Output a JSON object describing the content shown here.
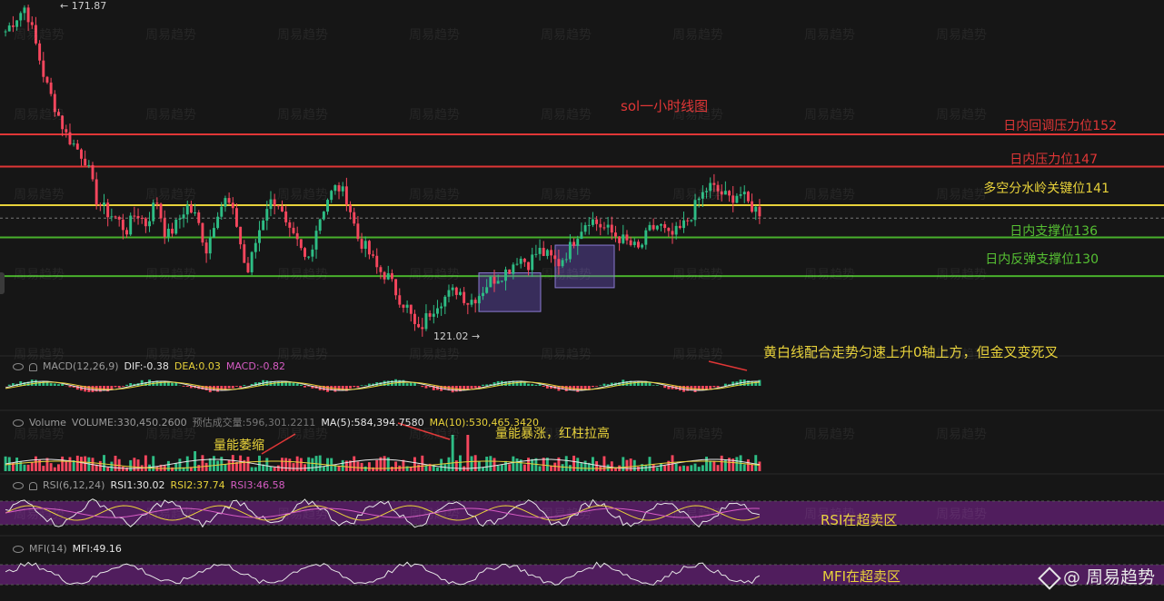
{
  "chart_data": {
    "type": "candlestick",
    "title": "sol一小时线图",
    "price": {
      "high_marker": "171.87",
      "low_marker": "121.02"
    },
    "levels": [
      {
        "label": "日内回调压力位152",
        "value": 152,
        "color": "#e03636"
      },
      {
        "label": "日内压力位147",
        "value": 147,
        "color": "#e03636"
      },
      {
        "label": "多空分水岭关键位141",
        "value": 141,
        "color": "#e8d23a"
      },
      {
        "label": "日内支撑位136",
        "value": 136,
        "color": "#48b02c"
      },
      {
        "label": "日内反弹支撑位130",
        "value": 130,
        "color": "#48b02c"
      }
    ],
    "current_price_dashed": 139,
    "consolidation_boxes": [
      {
        "from_price": 124.5,
        "to_price": 130.5
      },
      {
        "from_price": 128.2,
        "to_price": 134.8
      }
    ],
    "close_path": [
      168,
      170,
      171.87,
      166,
      160,
      156,
      152,
      150,
      148,
      142,
      140,
      139,
      137,
      140,
      138,
      142,
      136,
      138,
      141,
      139,
      134,
      140,
      142,
      138,
      130,
      136,
      141,
      142,
      137,
      135,
      132,
      138,
      142,
      144,
      142,
      136,
      134,
      131,
      130,
      127,
      125,
      121.02,
      124,
      126,
      127,
      128,
      126,
      127,
      129,
      130,
      131,
      133,
      132,
      134,
      133,
      132,
      134,
      137,
      139,
      138,
      137,
      136,
      135,
      134,
      137,
      138,
      136,
      137,
      139,
      142,
      144,
      143,
      142,
      143,
      141,
      140
    ],
    "macd": {
      "params": "MACD(12,26,9)",
      "dif": "DIF:-0.38",
      "dea": "DEA:0.03",
      "macd": "MACD:-0.82"
    },
    "volume": {
      "label": "Volume",
      "volume": "VOLUME:330,450.2600",
      "turnover": "预估成交量:596,301.2211",
      "ma5": "MA(5):584,394.7580",
      "ma10": "MA(10):530,465.3420"
    },
    "rsi": {
      "params": "RSI(6,12,24)",
      "rsi1": "RSI1:30.02",
      "rsi2": "RSI2:37.74",
      "rsi3": "RSI3:46.58"
    },
    "mfi": {
      "params": "MFI(14)",
      "value": "MFI:49.16"
    }
  },
  "annotations": {
    "macd_note": "黄白线配合走势匀速上升0轴上方，但金叉变死叉",
    "vol_shrink": "量能萎缩",
    "vol_surge": "量能暴涨，红柱拉高",
    "rsi_note": "RSI在超卖区",
    "mfi_note": "MFI在超卖区"
  },
  "brand": "@ 周易趋势",
  "watermark": "周易趋势",
  "colors": {
    "up": "#2ebd85",
    "down": "#f6465d",
    "yellow": "#e8d23a",
    "white": "#e6e6e6",
    "pink": "#d65cc4",
    "purple_band": "#5a1f6a"
  }
}
